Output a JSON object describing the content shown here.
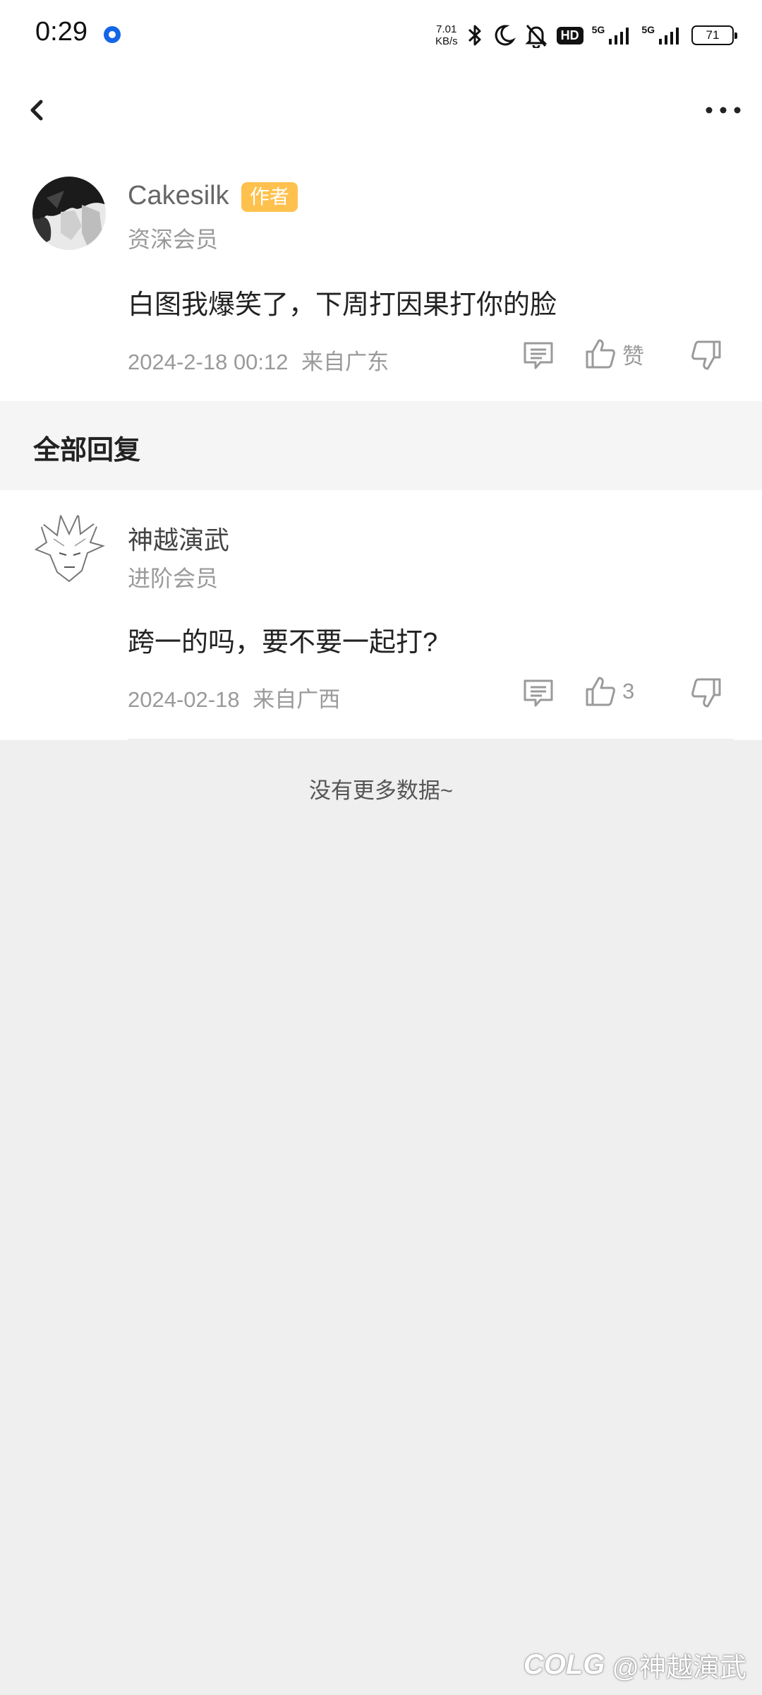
{
  "status_bar": {
    "time": "0:29",
    "net_speed_value": "7.01",
    "net_speed_unit": "KB/s",
    "hd_label": "HD",
    "network_1": "5G",
    "network_2": "5G",
    "battery": "71"
  },
  "post": {
    "author": "Cakesilk",
    "author_badge": "作者",
    "member_level": "资深会员",
    "content": "白图我爆笑了，下周打因果打你的脸",
    "date": "2024-2-18 00:12",
    "location": "来自广东",
    "like_label": "赞"
  },
  "section_title": "全部回复",
  "replies": [
    {
      "author": "神越演武",
      "member_level": "进阶会员",
      "content": "跨一的吗，要不要一起打?",
      "date": "2024-02-18",
      "location": "来自广西",
      "like_count": "3"
    }
  ],
  "footer_text": "没有更多数据~",
  "watermark": {
    "logo": "COLG",
    "user": "@神越演武"
  },
  "colors": {
    "badge": "#ffc14d",
    "accent_blue": "#1565e8",
    "page_bg": "#efefef"
  }
}
